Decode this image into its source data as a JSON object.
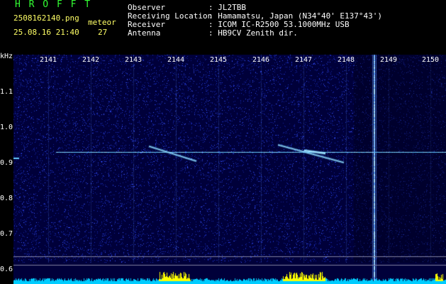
{
  "app": {
    "title": "H R O F F T"
  },
  "file": {
    "name": "2508162140.png",
    "datetime": "25.08.16 21:40"
  },
  "meteor": {
    "label": "meteor",
    "count": "27"
  },
  "info": [
    {
      "label": "Observer",
      "value": ": JL2TBB"
    },
    {
      "label": "Receiving Location",
      "value": ": Hamamatsu, Japan (N34°40' E137°43')"
    },
    {
      "label": "Receiver",
      "value": ": ICOM IC-R2500 53.1000MHz USB"
    },
    {
      "label": "Antenna",
      "value": ": HB9CV Zenith dir."
    }
  ],
  "axes": {
    "y_unit": "kHz",
    "y_ticks": [
      "1.1",
      "1.0",
      "0.9",
      "0.8",
      "0.7",
      "0.6"
    ],
    "x_ticks": [
      "2141",
      "2142",
      "2143",
      "2144",
      "2145",
      "2146",
      "2147",
      "2148",
      "2149",
      "2150"
    ]
  },
  "colors": {
    "background": "#00003a",
    "noise": "#1a2ab0",
    "signal": "#66ccff",
    "strong": "#e8ffff",
    "gridline": "#8080a0",
    "activity_base": "#00ccff",
    "activity_peak": "#ffff00"
  }
}
